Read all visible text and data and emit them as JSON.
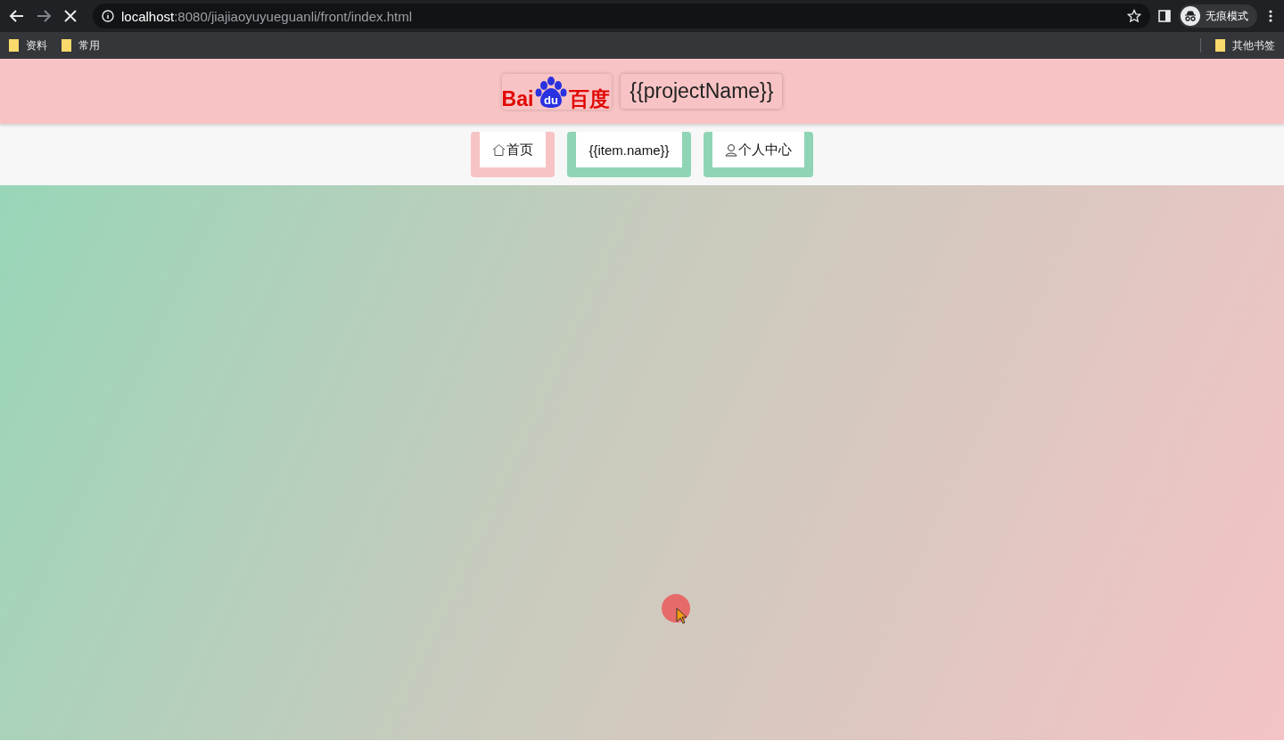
{
  "browser": {
    "address": {
      "host": "localhost",
      "path": ":8080/jiajiaoyuyueguanli/front/index.html"
    },
    "profile": "无痕模式",
    "bookmarks": [
      "资料",
      "常用"
    ],
    "other_bookmarks": "其他书签"
  },
  "header": {
    "logo": {
      "left": "Bai",
      "badge": "du",
      "right": "百度"
    },
    "project_name": "{{projectName}}"
  },
  "nav": [
    {
      "label": "首页",
      "kind": "home",
      "selected": true
    },
    {
      "label": "{{item.name}}",
      "kind": "plain",
      "selected": false
    },
    {
      "label": "个人中心",
      "kind": "user",
      "selected": false
    }
  ]
}
